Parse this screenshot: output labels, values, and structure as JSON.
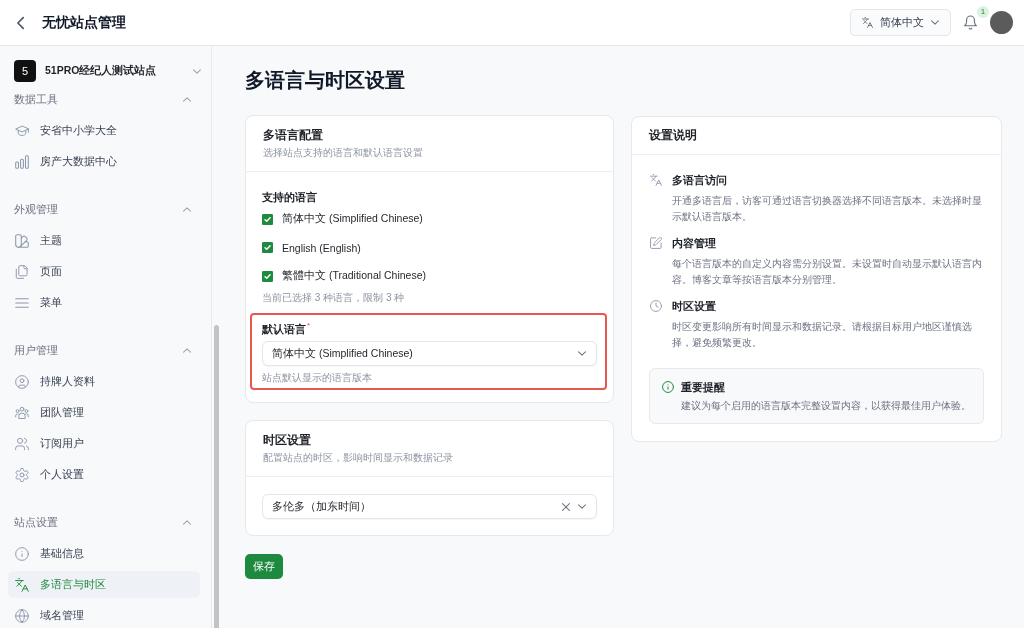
{
  "header": {
    "title": "无忧站点管理",
    "language": "简体中文",
    "notification_count": "1"
  },
  "sidebar": {
    "site": {
      "logo": "5",
      "name": "51PRO经纪人测试站点"
    },
    "sections": [
      {
        "title": "数据工具",
        "expanded": true,
        "items": [
          {
            "label": "安省中小学大全",
            "selected": false
          },
          {
            "label": "房产大数据中心",
            "selected": false
          }
        ]
      },
      {
        "title": "外观管理",
        "expanded": true,
        "items": [
          {
            "label": "主题",
            "selected": false
          },
          {
            "label": "页面",
            "selected": false
          },
          {
            "label": "菜单",
            "selected": false
          }
        ]
      },
      {
        "title": "用户管理",
        "expanded": true,
        "items": [
          {
            "label": "持牌人资料",
            "selected": false
          },
          {
            "label": "团队管理",
            "selected": false
          },
          {
            "label": "订阅用户",
            "selected": false
          },
          {
            "label": "个人设置",
            "selected": false
          }
        ]
      },
      {
        "title": "站点设置",
        "expanded": true,
        "items": [
          {
            "label": "基础信息",
            "selected": false
          },
          {
            "label": "多语言与时区",
            "selected": true
          },
          {
            "label": "域名管理",
            "selected": false
          }
        ]
      }
    ]
  },
  "page_title": "多语言与时区设置",
  "language_card": {
    "title": "多语言配置",
    "subtitle": "选择站点支持的语言和默认语言设置",
    "supported_label": "支持的语言",
    "languages": [
      {
        "label": "简体中文 (Simplified Chinese)",
        "checked": true
      },
      {
        "label": "English (English)",
        "checked": true
      },
      {
        "label": "繁體中文 (Traditional Chinese)",
        "checked": true
      }
    ],
    "selection_note": "当前已选择 3 种语言，限制 3 种",
    "default_language": {
      "label": "默认语言",
      "required_mark": "*",
      "value": "简体中文 (Simplified Chinese)",
      "help": "站点默认显示的语言版本",
      "highlighted": true
    }
  },
  "timezone_card": {
    "title": "时区设置",
    "subtitle": "配置站点的时区，影响时间显示和数据记录",
    "value": "多伦多（加东时间）",
    "clearable": true
  },
  "save_button": "保存",
  "help_card": {
    "title": "设置说明",
    "items": [
      {
        "title": "多语言访问",
        "text": "开通多语言后，访客可通过语言切换器选择不同语言版本。未选择时显示默认语言版本。"
      },
      {
        "title": "内容管理",
        "text": "每个语言版本的自定义内容需分别设置。未设置时自动显示默认语言内容。博客文章等按语言版本分别管理。"
      },
      {
        "title": "时区设置",
        "text": "时区变更影响所有时间显示和数据记录。请根据目标用户地区谨慎选择，避免频繁更改。"
      }
    ],
    "notice": {
      "title": "重要提醒",
      "text": "建议为每个启用的语言版本完整设置内容，以获得最佳用户体验。"
    }
  }
}
